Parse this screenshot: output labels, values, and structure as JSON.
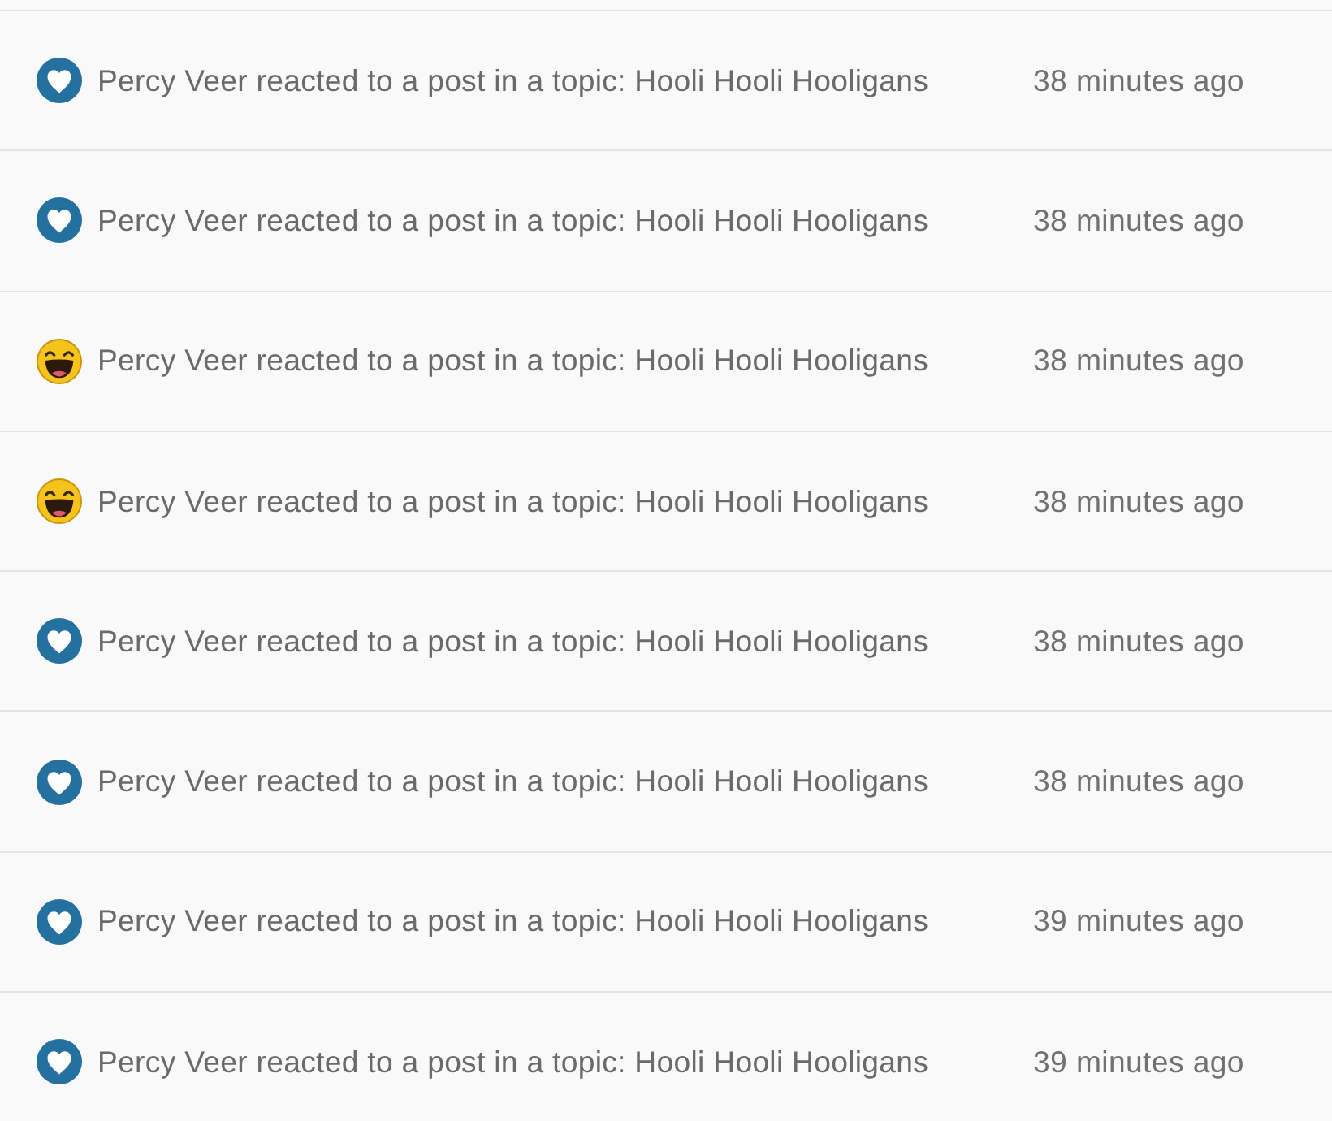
{
  "notifications": [
    {
      "kind": "heart",
      "text": "Percy Veer reacted to a post in a topic: Hooli Hooli Hooligans",
      "time": "38 minutes ago"
    },
    {
      "kind": "heart",
      "text": "Percy Veer reacted to a post in a topic: Hooli Hooli Hooligans",
      "time": "38 minutes ago"
    },
    {
      "kind": "laugh",
      "text": "Percy Veer reacted to a post in a topic: Hooli Hooli Hooligans",
      "time": "38 minutes ago"
    },
    {
      "kind": "laugh",
      "text": "Percy Veer reacted to a post in a topic: Hooli Hooli Hooligans",
      "time": "38 minutes ago"
    },
    {
      "kind": "heart",
      "text": "Percy Veer reacted to a post in a topic: Hooli Hooli Hooligans",
      "time": "38 minutes ago"
    },
    {
      "kind": "heart",
      "text": "Percy Veer reacted to a post in a topic: Hooli Hooli Hooligans",
      "time": "38 minutes ago"
    },
    {
      "kind": "heart",
      "text": "Percy Veer reacted to a post in a topic: Hooli Hooli Hooligans",
      "time": "39 minutes ago"
    },
    {
      "kind": "heart",
      "text": "Percy Veer reacted to a post in a topic: Hooli Hooli Hooligans",
      "time": "39 minutes ago"
    }
  ]
}
